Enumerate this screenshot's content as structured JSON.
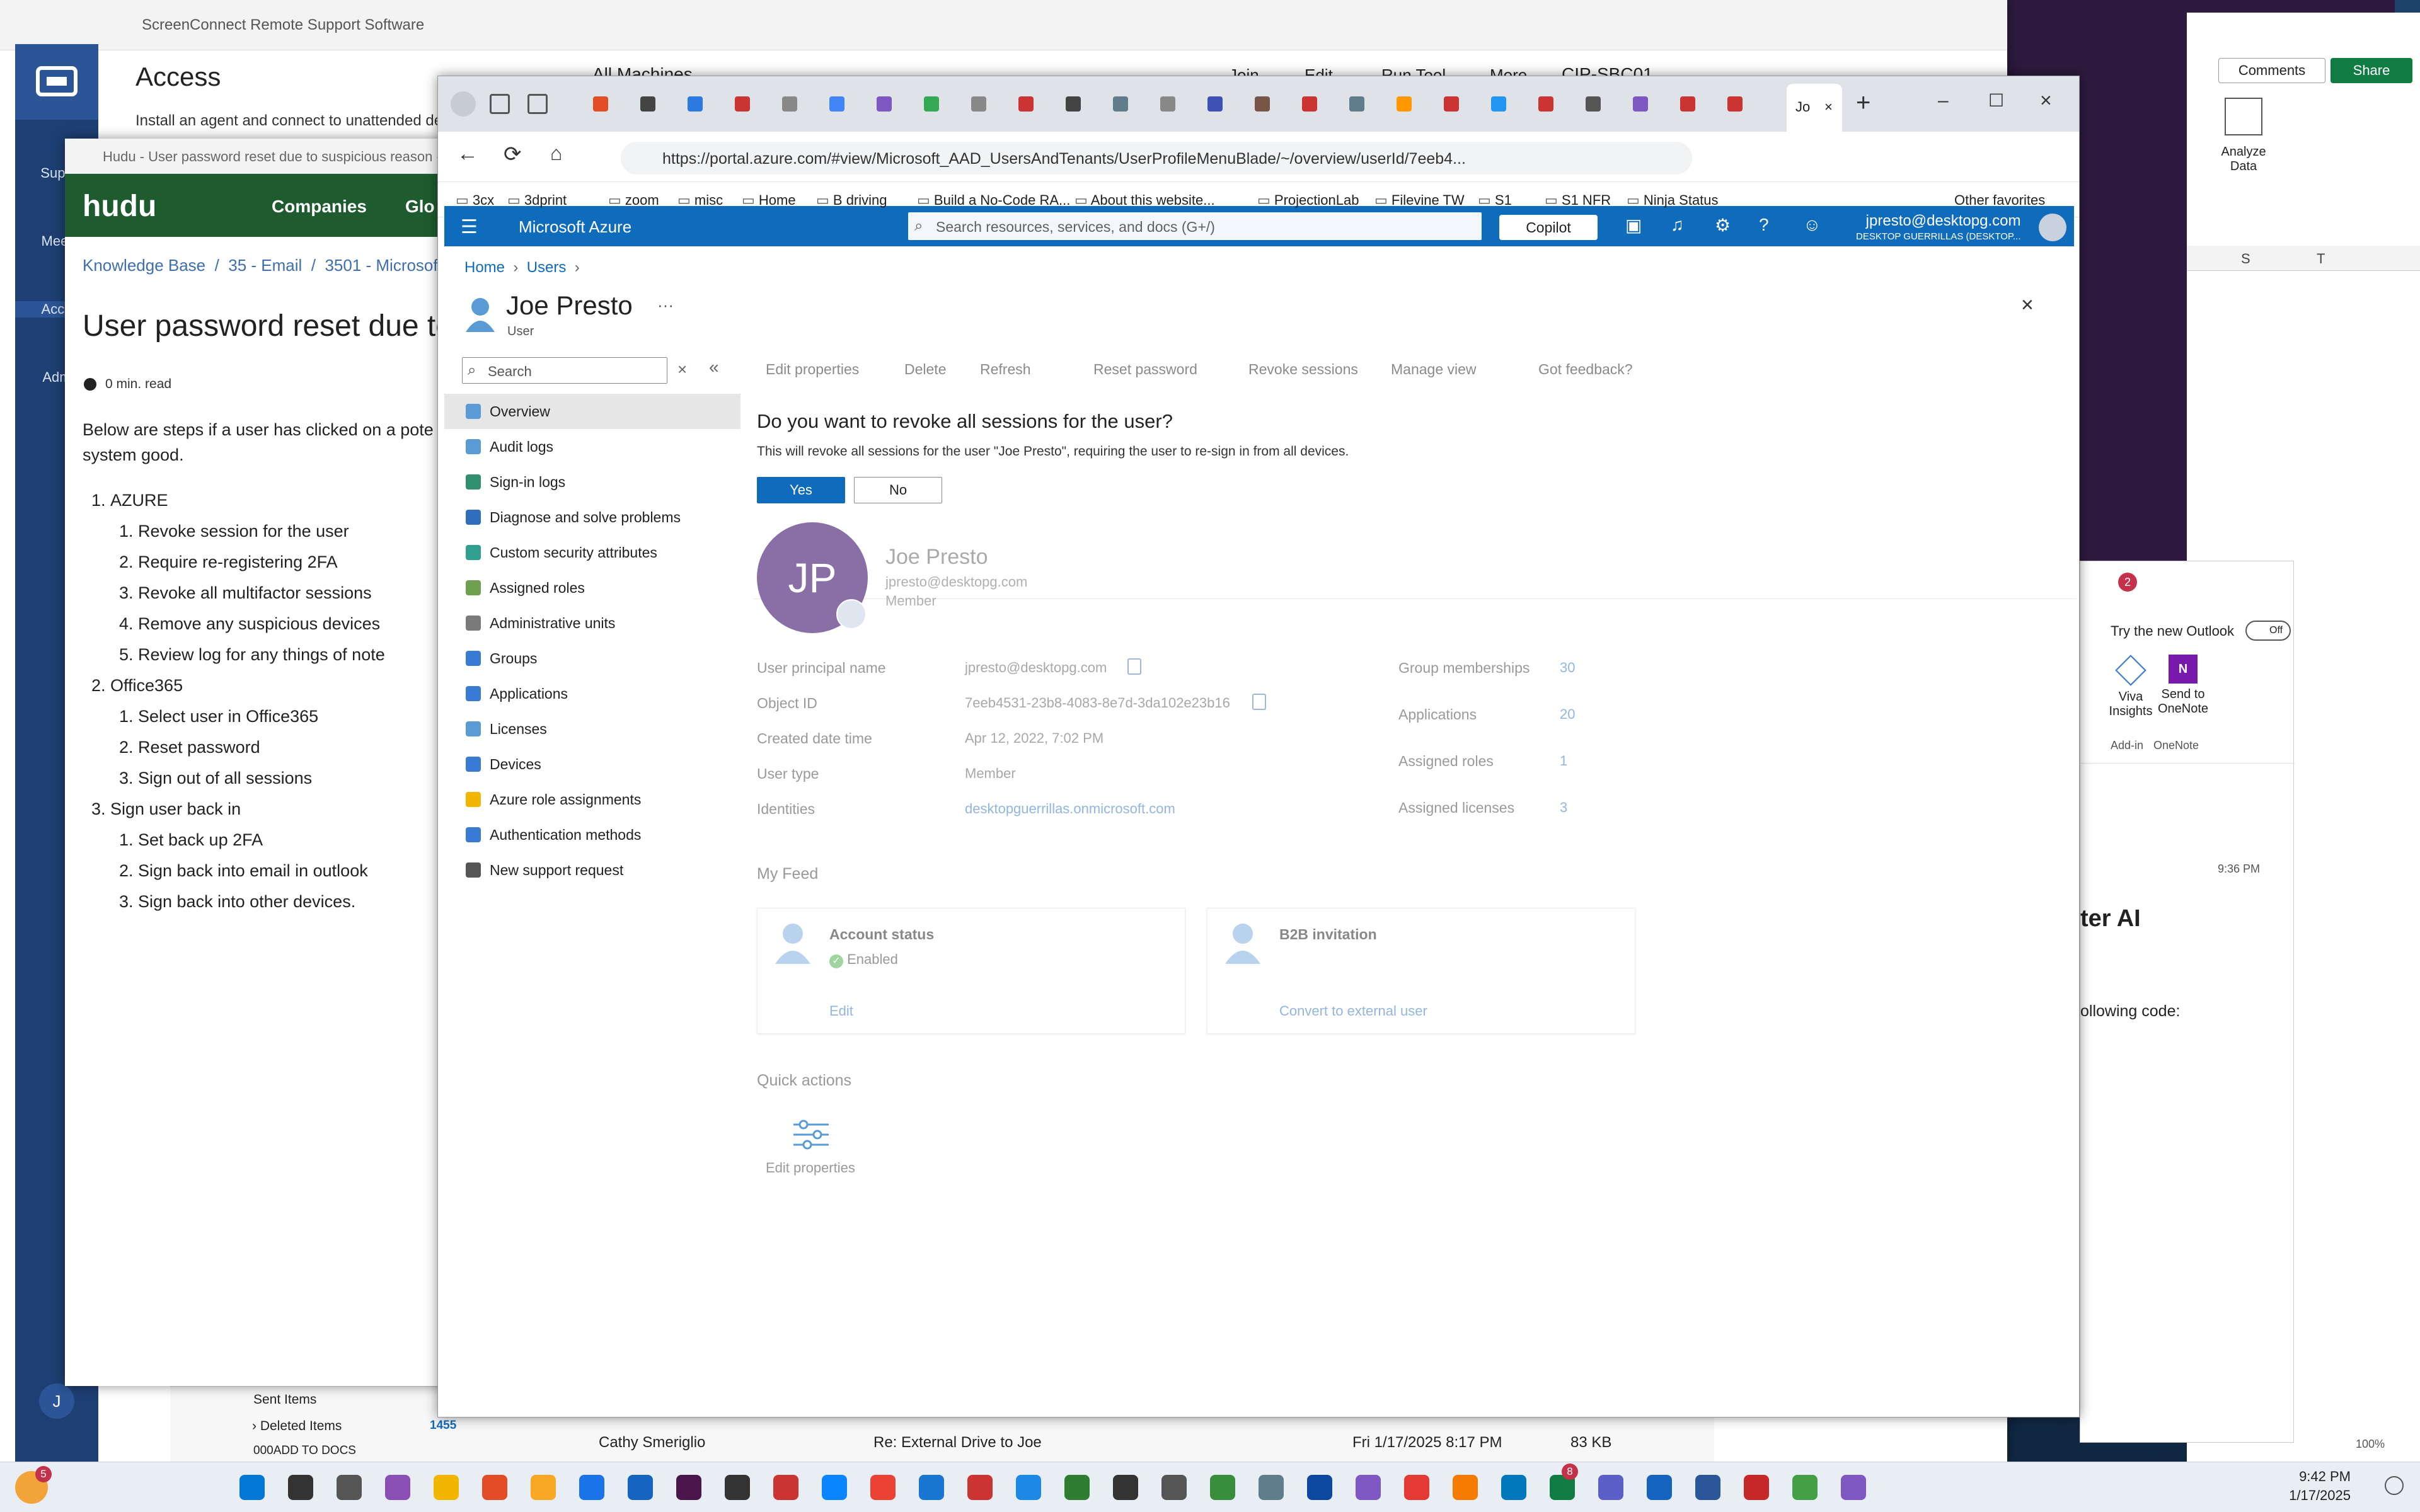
{
  "screenconnect": {
    "window_title": "ScreenConnect Remote Support Software",
    "page_title": "Access",
    "subtitle": "Install an agent and connect to unattended devi",
    "nav": [
      "Supp",
      "Meet",
      "Acce",
      "Adm"
    ],
    "all_machines": "All Machines",
    "toolbar": [
      "Join",
      "Edit",
      "Run Tool",
      "More"
    ],
    "machine": "CIP-SBC01"
  },
  "hudu": {
    "window_title": "Hudu - User password reset due to suspicious reason - Des",
    "logo": "hudu",
    "nav_companies": "Companies",
    "nav_global": "Glo",
    "breadcrumb": [
      "Knowledge Base",
      "35 - Email",
      "3501 - Microsoft"
    ],
    "page_title": "User password reset due to s",
    "read_time": "0 min. read",
    "intro": "Below are steps if a user has clicked on a pote sure system good.",
    "steps": [
      {
        "title": "AZURE",
        "sub": [
          "Revoke session for the user",
          "Require re-registering 2FA",
          "Revoke all multifactor sessions",
          "Remove any suspicious devices",
          "Review log for any things of note"
        ]
      },
      {
        "title": "Office365",
        "sub": [
          "Select user in Office365",
          "Reset password",
          "Sign out of all sessions"
        ]
      },
      {
        "title": "Sign user back in",
        "sub": [
          "Set back up 2FA",
          "Sign back into email in outlook",
          "Sign back into other devices."
        ]
      }
    ]
  },
  "edge": {
    "active_tab": "Jo",
    "url": "https://portal.azure.com/#view/Microsoft_AAD_UsersAndTenants/UserProfileMenuBlade/~/overview/userId/7eeb4...",
    "favorites": [
      "3cx",
      "3dprint",
      "zoom",
      "misc",
      "Home",
      "B driving",
      "Build a No-Code RA...",
      "About this website...",
      "ProjectionLab",
      "Filevine TW",
      "S1",
      "S1 NFR",
      "Ninja Status"
    ],
    "other_favorites": "Other favorites"
  },
  "azure": {
    "brand": "Microsoft Azure",
    "search_placeholder": "Search resources, services, and docs (G+/)",
    "copilot": "Copilot",
    "user_email": "jpresto@desktopg.com",
    "user_tenant": "DESKTOP GUERRILLAS (DESKTOP...",
    "breadcrumb_home": "Home",
    "breadcrumb_users": "Users",
    "user_name": "Joe Presto",
    "user_type": "User",
    "nav_search": "Search",
    "nav": [
      "Overview",
      "Audit logs",
      "Sign-in logs",
      "Diagnose and solve problems",
      "Custom security attributes",
      "Assigned roles",
      "Administrative units",
      "Groups",
      "Applications",
      "Licenses",
      "Devices",
      "Azure role assignments",
      "Authentication methods",
      "New support request"
    ],
    "toolbar": [
      "Edit properties",
      "Delete",
      "Refresh",
      "Reset password",
      "Revoke sessions",
      "Manage view",
      "Got feedback?"
    ],
    "dialog": {
      "title": "Do you want to revoke all sessions for the user?",
      "message": "This will revoke all sessions for the user \"Joe Presto\", requiring the user to re-sign in from all devices.",
      "yes": "Yes",
      "no": "No"
    },
    "profile": {
      "initials": "JP",
      "name": "Joe Presto",
      "email": "jpresto@desktopg.com",
      "role": "Member"
    },
    "properties_left": [
      {
        "label": "User principal name",
        "value": "jpresto@desktopg.com"
      },
      {
        "label": "Object ID",
        "value": "7eeb4531-23b8-4083-8e7d-3da102e23b16"
      },
      {
        "label": "Created date time",
        "value": "Apr 12, 2022, 7:02 PM"
      },
      {
        "label": "User type",
        "value": "Member"
      },
      {
        "label": "Identities",
        "value": "desktopguerrillas.onmicrosoft.com"
      }
    ],
    "properties_right": [
      {
        "label": "Group memberships",
        "value": "30"
      },
      {
        "label": "Applications",
        "value": "20"
      },
      {
        "label": "Assigned roles",
        "value": "1"
      },
      {
        "label": "Assigned licenses",
        "value": "3"
      }
    ],
    "feed_title": "My Feed",
    "feed_cards": [
      {
        "title": "Account status",
        "status": "Enabled",
        "action": "Edit"
      },
      {
        "title": "B2B invitation",
        "status": "",
        "action": "Convert to external user"
      }
    ],
    "quick_actions_title": "Quick actions",
    "quick_action": "Edit properties"
  },
  "right_windows": {
    "comments": "Comments",
    "share": "Share",
    "analyze_data": "Analyze Data",
    "col_s": "S",
    "col_t": "T",
    "outlook_try": "Try the new Outlook",
    "outlook_off": "Off",
    "viva": "Viva Insights",
    "addin": "Add-in",
    "send_onenote": "Send to OneNote",
    "onenote": "OneNote",
    "time": "9:36 PM",
    "heading": "ter AI",
    "code_text": "ollowing code:",
    "badge": "2",
    "zoom": "100%"
  },
  "outlook_list": {
    "sent_items": "Sent Items",
    "deleted_items": "Deleted Items",
    "deleted_count": "1455",
    "add_to_docs": "000ADD TO DOCS",
    "sender": "Cathy Smeriglio",
    "subject": "Re: External Drive to Joe",
    "date": "Fri 1/17/2025 8:17 PM",
    "size": "83 KB"
  },
  "taskbar": {
    "time": "9:42 PM",
    "date": "1/17/2025",
    "badge": "5",
    "teams_badge": "8"
  },
  "colors": {
    "azure_blue": "#0f6cbd",
    "hudu_green": "#1e5c2f",
    "sc_navy": "#1e3f73",
    "avatar_purple": "#8a6fa6"
  }
}
